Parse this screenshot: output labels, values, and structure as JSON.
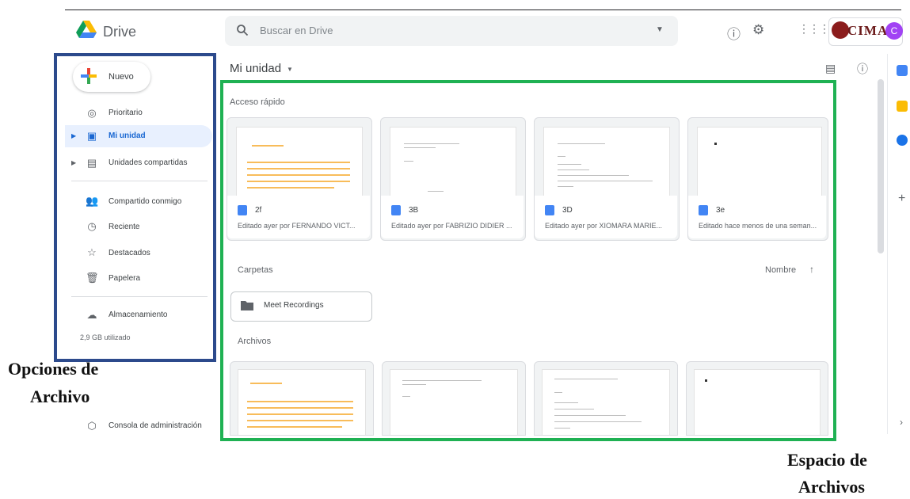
{
  "app": {
    "name": "Drive"
  },
  "search": {
    "placeholder": "Buscar en Drive"
  },
  "header": {
    "org_logo_text": "CIMA",
    "avatar_letter": "C"
  },
  "sidebar": {
    "new_label": "Nuevo",
    "items": [
      {
        "label": "Prioritario",
        "icon": "checkbox-circle-icon"
      },
      {
        "label": "Mi unidad",
        "icon": "drive-icon",
        "selected": true
      },
      {
        "label": "Unidades compartidas",
        "icon": "shared-drives-icon"
      },
      {
        "label": "Compartido conmigo",
        "icon": "people-icon"
      },
      {
        "label": "Reciente",
        "icon": "clock-icon"
      },
      {
        "label": "Destacados",
        "icon": "star-icon"
      },
      {
        "label": "Papelera",
        "icon": "trash-icon"
      }
    ],
    "storage_label": "Almacenamiento",
    "storage_used": "2,9 GB utilizado",
    "admin_label": "Consola de administración"
  },
  "main": {
    "title": "Mi unidad",
    "quick_access_label": "Acceso rápido",
    "quick_access": [
      {
        "name": "2f",
        "subtitle": "Editado ayer por FERNANDO VICT..."
      },
      {
        "name": "3B",
        "subtitle": "Editado ayer por FABRIZIO DIDIER ..."
      },
      {
        "name": "3D",
        "subtitle": "Editado ayer por XIOMARA MARIE..."
      },
      {
        "name": "3e",
        "subtitle": "Editado hace menos de una seman..."
      }
    ],
    "folders_label": "Carpetas",
    "sort_label": "Nombre",
    "folders": [
      {
        "name": "Meet Recordings"
      }
    ],
    "files_label": "Archivos"
  },
  "annotations": {
    "left_caption_line1": "Opciones de",
    "left_caption_line2": "Archivo",
    "right_caption_line1": "Espacio de",
    "right_caption_line2": "Archivos"
  },
  "colors": {
    "sidebar_box": "#2c4a8c",
    "workspace_box": "#1fb153",
    "selected_bg": "#e8f0fe",
    "accent": "#1967d2"
  }
}
